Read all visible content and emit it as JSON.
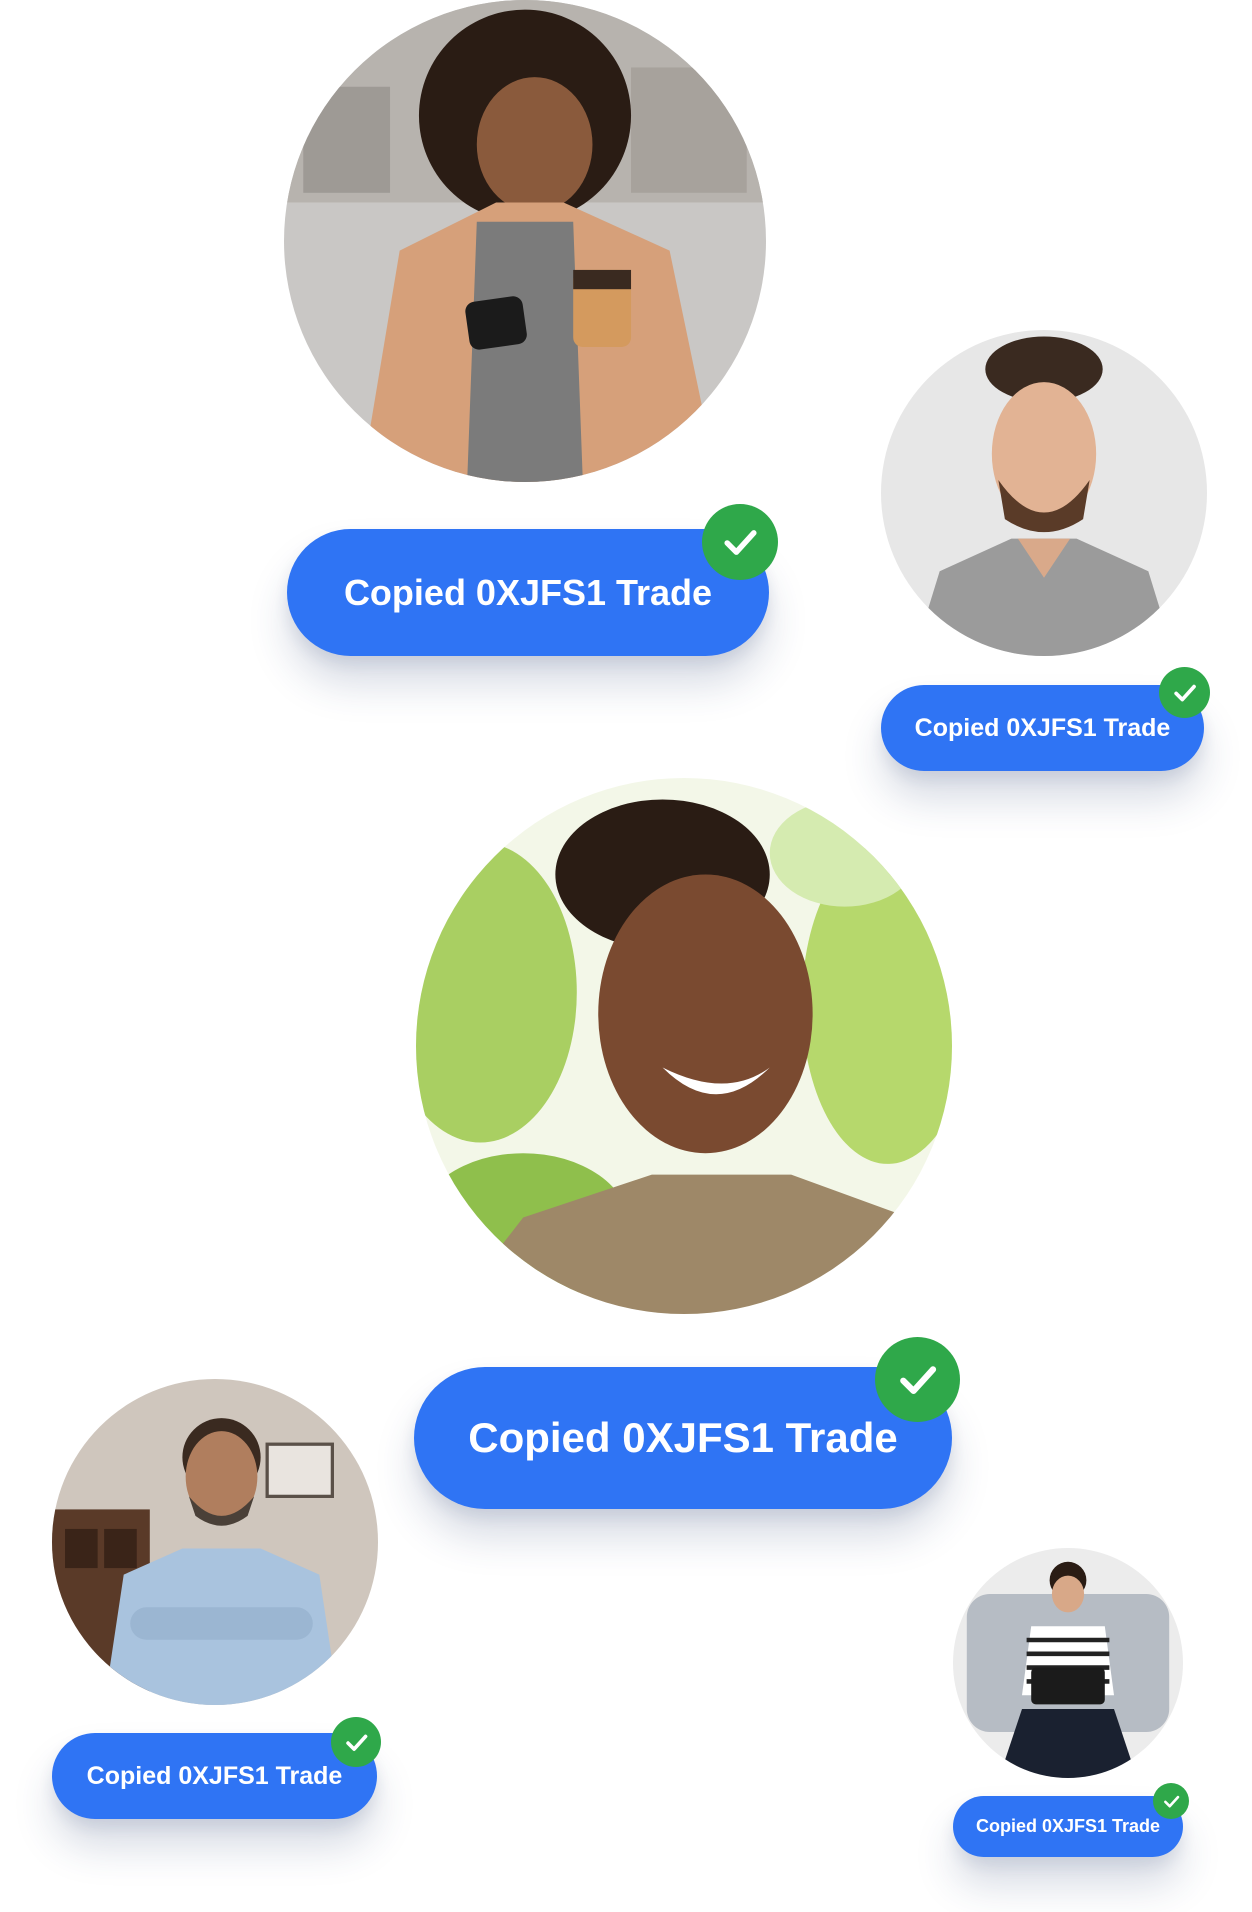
{
  "cards": [
    {
      "id": "woman-coffee",
      "label": "Copied 0XJFS1 Trade"
    },
    {
      "id": "man-gray-shirt",
      "label": "Copied 0XJFS1 Trade"
    },
    {
      "id": "woman-smiling",
      "label": "Copied 0XJFS1 Trade"
    },
    {
      "id": "man-glasses",
      "label": "Copied 0XJFS1 Trade"
    },
    {
      "id": "man-laptop",
      "label": "Copied 0XJFS1 Trade"
    }
  ],
  "icons": {
    "check": "check-icon"
  },
  "colors": {
    "pill": "#2f74f4",
    "check": "#2fa84a",
    "text": "#ffffff"
  }
}
